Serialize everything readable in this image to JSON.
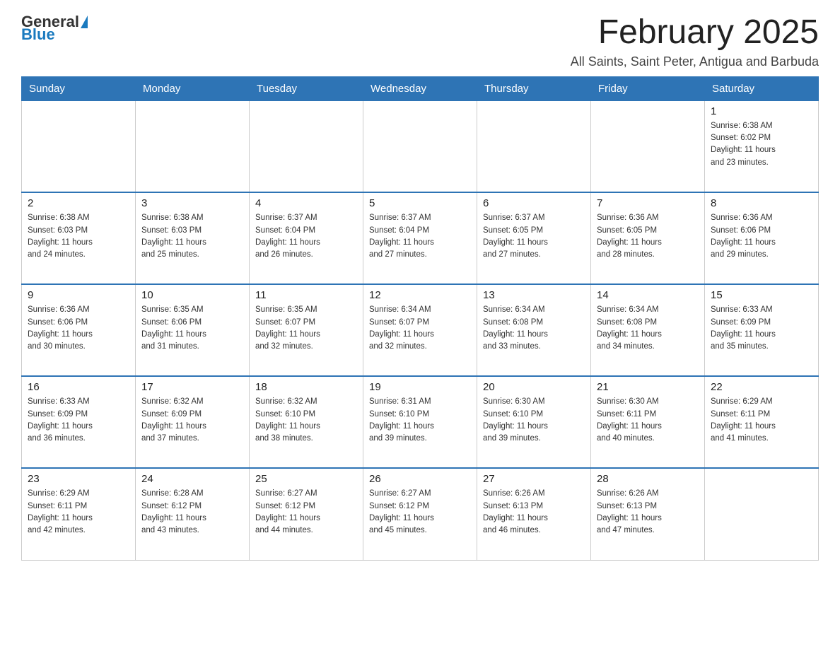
{
  "logo": {
    "general": "General",
    "triangle": "▲",
    "blue": "Blue"
  },
  "header": {
    "month": "February 2025",
    "location": "All Saints, Saint Peter, Antigua and Barbuda"
  },
  "days_of_week": [
    "Sunday",
    "Monday",
    "Tuesday",
    "Wednesday",
    "Thursday",
    "Friday",
    "Saturday"
  ],
  "weeks": [
    [
      {
        "day": "",
        "info": ""
      },
      {
        "day": "",
        "info": ""
      },
      {
        "day": "",
        "info": ""
      },
      {
        "day": "",
        "info": ""
      },
      {
        "day": "",
        "info": ""
      },
      {
        "day": "",
        "info": ""
      },
      {
        "day": "1",
        "info": "Sunrise: 6:38 AM\nSunset: 6:02 PM\nDaylight: 11 hours\nand 23 minutes."
      }
    ],
    [
      {
        "day": "2",
        "info": "Sunrise: 6:38 AM\nSunset: 6:03 PM\nDaylight: 11 hours\nand 24 minutes."
      },
      {
        "day": "3",
        "info": "Sunrise: 6:38 AM\nSunset: 6:03 PM\nDaylight: 11 hours\nand 25 minutes."
      },
      {
        "day": "4",
        "info": "Sunrise: 6:37 AM\nSunset: 6:04 PM\nDaylight: 11 hours\nand 26 minutes."
      },
      {
        "day": "5",
        "info": "Sunrise: 6:37 AM\nSunset: 6:04 PM\nDaylight: 11 hours\nand 27 minutes."
      },
      {
        "day": "6",
        "info": "Sunrise: 6:37 AM\nSunset: 6:05 PM\nDaylight: 11 hours\nand 27 minutes."
      },
      {
        "day": "7",
        "info": "Sunrise: 6:36 AM\nSunset: 6:05 PM\nDaylight: 11 hours\nand 28 minutes."
      },
      {
        "day": "8",
        "info": "Sunrise: 6:36 AM\nSunset: 6:06 PM\nDaylight: 11 hours\nand 29 minutes."
      }
    ],
    [
      {
        "day": "9",
        "info": "Sunrise: 6:36 AM\nSunset: 6:06 PM\nDaylight: 11 hours\nand 30 minutes."
      },
      {
        "day": "10",
        "info": "Sunrise: 6:35 AM\nSunset: 6:06 PM\nDaylight: 11 hours\nand 31 minutes."
      },
      {
        "day": "11",
        "info": "Sunrise: 6:35 AM\nSunset: 6:07 PM\nDaylight: 11 hours\nand 32 minutes."
      },
      {
        "day": "12",
        "info": "Sunrise: 6:34 AM\nSunset: 6:07 PM\nDaylight: 11 hours\nand 32 minutes."
      },
      {
        "day": "13",
        "info": "Sunrise: 6:34 AM\nSunset: 6:08 PM\nDaylight: 11 hours\nand 33 minutes."
      },
      {
        "day": "14",
        "info": "Sunrise: 6:34 AM\nSunset: 6:08 PM\nDaylight: 11 hours\nand 34 minutes."
      },
      {
        "day": "15",
        "info": "Sunrise: 6:33 AM\nSunset: 6:09 PM\nDaylight: 11 hours\nand 35 minutes."
      }
    ],
    [
      {
        "day": "16",
        "info": "Sunrise: 6:33 AM\nSunset: 6:09 PM\nDaylight: 11 hours\nand 36 minutes."
      },
      {
        "day": "17",
        "info": "Sunrise: 6:32 AM\nSunset: 6:09 PM\nDaylight: 11 hours\nand 37 minutes."
      },
      {
        "day": "18",
        "info": "Sunrise: 6:32 AM\nSunset: 6:10 PM\nDaylight: 11 hours\nand 38 minutes."
      },
      {
        "day": "19",
        "info": "Sunrise: 6:31 AM\nSunset: 6:10 PM\nDaylight: 11 hours\nand 39 minutes."
      },
      {
        "day": "20",
        "info": "Sunrise: 6:30 AM\nSunset: 6:10 PM\nDaylight: 11 hours\nand 39 minutes."
      },
      {
        "day": "21",
        "info": "Sunrise: 6:30 AM\nSunset: 6:11 PM\nDaylight: 11 hours\nand 40 minutes."
      },
      {
        "day": "22",
        "info": "Sunrise: 6:29 AM\nSunset: 6:11 PM\nDaylight: 11 hours\nand 41 minutes."
      }
    ],
    [
      {
        "day": "23",
        "info": "Sunrise: 6:29 AM\nSunset: 6:11 PM\nDaylight: 11 hours\nand 42 minutes."
      },
      {
        "day": "24",
        "info": "Sunrise: 6:28 AM\nSunset: 6:12 PM\nDaylight: 11 hours\nand 43 minutes."
      },
      {
        "day": "25",
        "info": "Sunrise: 6:27 AM\nSunset: 6:12 PM\nDaylight: 11 hours\nand 44 minutes."
      },
      {
        "day": "26",
        "info": "Sunrise: 6:27 AM\nSunset: 6:12 PM\nDaylight: 11 hours\nand 45 minutes."
      },
      {
        "day": "27",
        "info": "Sunrise: 6:26 AM\nSunset: 6:13 PM\nDaylight: 11 hours\nand 46 minutes."
      },
      {
        "day": "28",
        "info": "Sunrise: 6:26 AM\nSunset: 6:13 PM\nDaylight: 11 hours\nand 47 minutes."
      },
      {
        "day": "",
        "info": ""
      }
    ]
  ],
  "colors": {
    "header_bg": "#2e74b5",
    "header_text": "#ffffff",
    "border": "#cccccc",
    "title": "#222222"
  }
}
